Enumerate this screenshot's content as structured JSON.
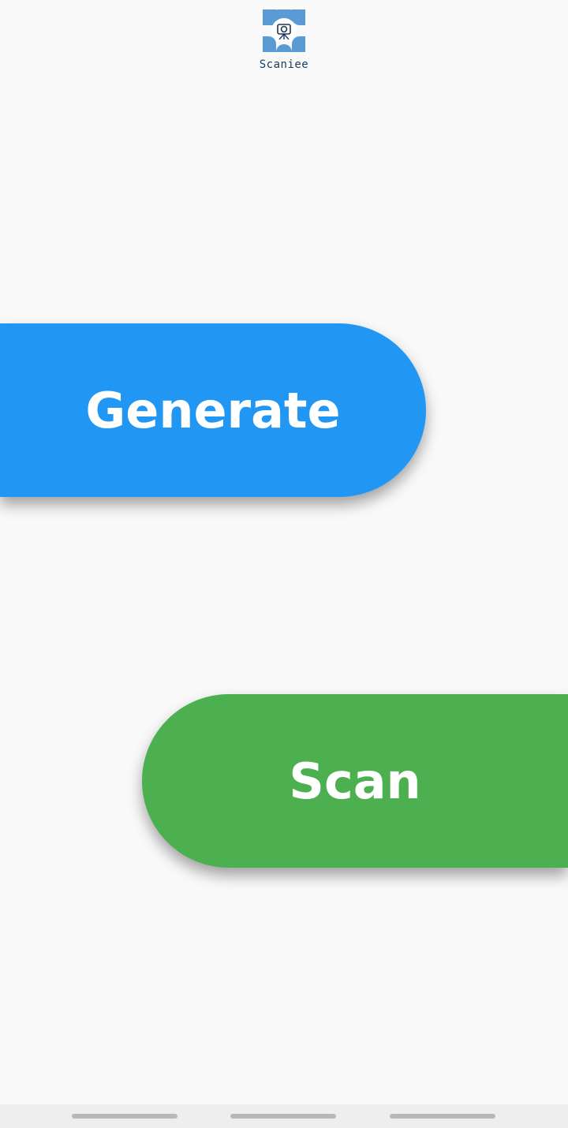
{
  "app": {
    "logo_text": "Scaniee",
    "logo_icon": "camera-tripod-icon",
    "logo_color": "#5b9bd5"
  },
  "actions": {
    "generate_label": "Generate",
    "generate_color": "#2296f3",
    "scan_label": "Scan",
    "scan_color": "#4caf50"
  },
  "nav": {
    "items": [
      "nav-pill",
      "nav-pill",
      "nav-pill"
    ]
  }
}
